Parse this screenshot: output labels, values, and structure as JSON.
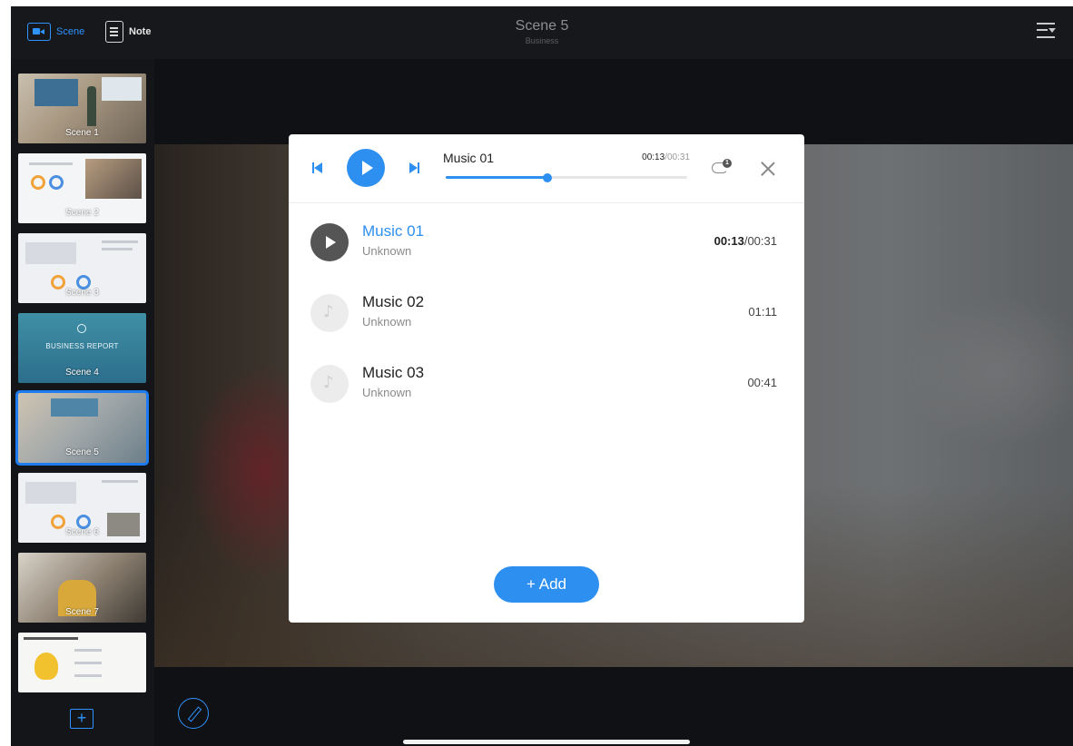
{
  "topbar": {
    "scene_label": "Scene",
    "note_label": "Note",
    "title": "Scene 5",
    "subtitle": "Business"
  },
  "sidebar": {
    "thumbnails": [
      {
        "label": "Scene 1",
        "selected": false
      },
      {
        "label": "Scene 2",
        "selected": false
      },
      {
        "label": "Scene 3",
        "selected": false
      },
      {
        "label": "Scene 4",
        "selected": false,
        "text": "BUSINESS REPORT"
      },
      {
        "label": "Scene 5",
        "selected": true
      },
      {
        "label": "Scene 6",
        "selected": false
      },
      {
        "label": "Scene 7",
        "selected": false
      },
      {
        "label": "",
        "selected": false
      }
    ]
  },
  "player": {
    "title": "Music 01",
    "current": "00:13",
    "total": "/00:31",
    "progress_fraction": 0.42,
    "loop_badge": "1"
  },
  "tracks": [
    {
      "name": "Music 01",
      "artist": "Unknown",
      "current": "00:13",
      "duration": "/00:31",
      "active": true
    },
    {
      "name": "Music 02",
      "artist": "Unknown",
      "current": "",
      "duration": "01:11",
      "active": false
    },
    {
      "name": "Music 03",
      "artist": "Unknown",
      "current": "",
      "duration": "00:41",
      "active": false
    }
  ],
  "add_label": "+ Add",
  "colors": {
    "accent": "#2d8ff0",
    "dark_bg": "#121316",
    "selected_outline": "#1e7cf0"
  }
}
